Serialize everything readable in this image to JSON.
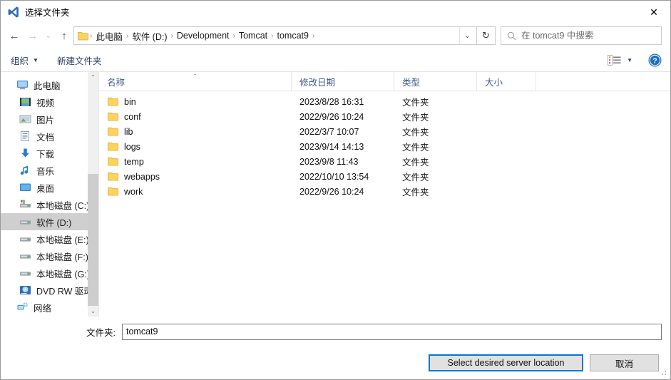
{
  "window": {
    "title": "选择文件夹",
    "app_icon": "vscode-icon",
    "close_label": "✕"
  },
  "nav": {
    "back_label": "←",
    "forward_label": "→",
    "recent_label": "⌄",
    "up_label": "↑",
    "refresh_label": "↻",
    "dropdown_label": "⌄",
    "separator": "›"
  },
  "breadcrumb": {
    "items": [
      "此电脑",
      "软件 (D:)",
      "Development",
      "Tomcat",
      "tomcat9"
    ]
  },
  "search": {
    "placeholder": "在 tomcat9 中搜索",
    "value": "",
    "icon": "search-icon"
  },
  "toolbar": {
    "organize_label": "组织",
    "organize_caret": "▼",
    "new_folder_label": "新建文件夹",
    "view_caret": "▼",
    "view_icon": "view-layout-icon",
    "help_icon": "help-icon"
  },
  "sidebar": {
    "scroll_up": "⌃",
    "scroll_down": "⌄",
    "items": [
      {
        "label": "此电脑",
        "icon": "this-pc-icon",
        "selected": false,
        "indent": false
      },
      {
        "label": "视频",
        "icon": "videos-icon",
        "selected": false,
        "indent": true
      },
      {
        "label": "图片",
        "icon": "pictures-icon",
        "selected": false,
        "indent": true
      },
      {
        "label": "文档",
        "icon": "documents-icon",
        "selected": false,
        "indent": true
      },
      {
        "label": "下载",
        "icon": "downloads-icon",
        "selected": false,
        "indent": true
      },
      {
        "label": "音乐",
        "icon": "music-icon",
        "selected": false,
        "indent": true
      },
      {
        "label": "桌面",
        "icon": "desktop-icon",
        "selected": false,
        "indent": true
      },
      {
        "label": "本地磁盘 (C:)",
        "icon": "system-drive-icon",
        "selected": false,
        "indent": true
      },
      {
        "label": "软件 (D:)",
        "icon": "drive-icon",
        "selected": true,
        "indent": true
      },
      {
        "label": "本地磁盘 (E:)",
        "icon": "drive-icon",
        "selected": false,
        "indent": true
      },
      {
        "label": "本地磁盘 (F:)",
        "icon": "drive-icon",
        "selected": false,
        "indent": true
      },
      {
        "label": "本地磁盘 (G:)",
        "icon": "drive-icon",
        "selected": false,
        "indent": true
      },
      {
        "label": "DVD RW 驱动器",
        "icon": "dvd-drive-icon",
        "selected": false,
        "indent": true
      },
      {
        "label": "网络",
        "icon": "network-icon",
        "selected": false,
        "indent": false
      }
    ]
  },
  "filelist": {
    "columns": {
      "name": "名称",
      "date": "修改日期",
      "type": "类型",
      "size": "大小"
    },
    "sort_caret": "⌃",
    "rows": [
      {
        "name": "bin",
        "date": "2023/8/28 16:31",
        "type": "文件夹",
        "size": ""
      },
      {
        "name": "conf",
        "date": "2022/9/26 10:24",
        "type": "文件夹",
        "size": ""
      },
      {
        "name": "lib",
        "date": "2022/3/7 10:07",
        "type": "文件夹",
        "size": ""
      },
      {
        "name": "logs",
        "date": "2023/9/14 14:13",
        "type": "文件夹",
        "size": ""
      },
      {
        "name": "temp",
        "date": "2023/9/8 11:43",
        "type": "文件夹",
        "size": ""
      },
      {
        "name": "webapps",
        "date": "2022/10/10 13:54",
        "type": "文件夹",
        "size": ""
      },
      {
        "name": "work",
        "date": "2022/9/26 10:24",
        "type": "文件夹",
        "size": ""
      }
    ]
  },
  "footer": {
    "folder_label": "文件夹:",
    "folder_value": "tomcat9",
    "select_button": "Select desired server location",
    "cancel_button": "取消"
  },
  "colors": {
    "accent": "#0078d7",
    "folder_yellow": "#ffd35c",
    "header_text": "#3c5a8a",
    "selection": "#cfcfcf"
  }
}
